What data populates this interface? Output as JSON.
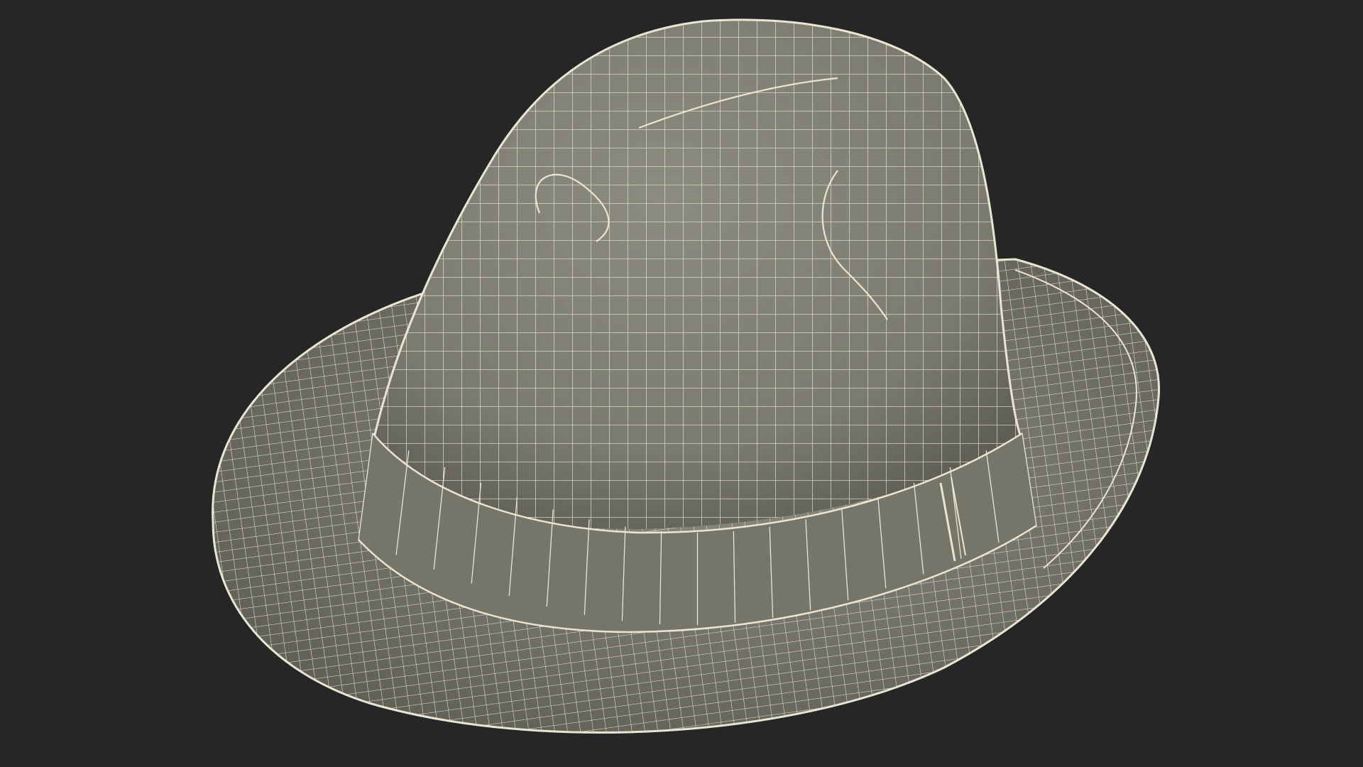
{
  "scene": {
    "background_color": "#262626",
    "model": {
      "subject": "fedora-hat",
      "surface_color": "#7c7b70",
      "surface_shadow_color": "#5f5e55",
      "surface_highlight_color": "#8c8b80",
      "band_color": "#76756a",
      "wire_color": "#e8e6d2"
    }
  }
}
